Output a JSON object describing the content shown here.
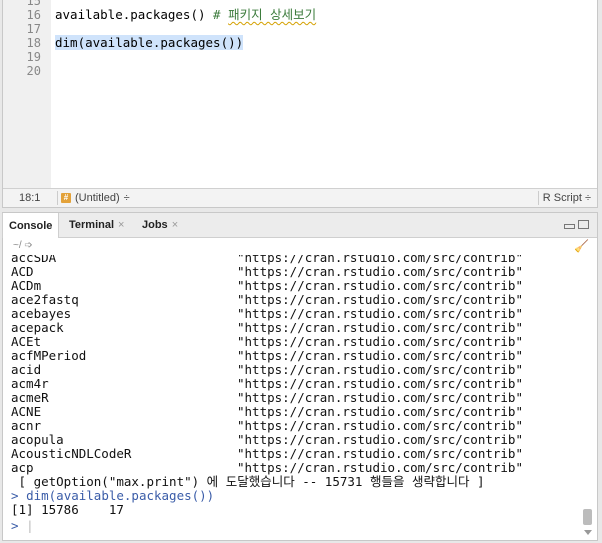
{
  "editor": {
    "lines": [
      {
        "num": "15",
        "text": ""
      },
      {
        "num": "16",
        "code": "available.packages() ",
        "comment_prefix": "# ",
        "comment_text": "패키지 상세보기"
      },
      {
        "num": "17",
        "text": ""
      },
      {
        "num": "18",
        "code": "dim(available.packages())"
      },
      {
        "num": "19",
        "text": ""
      },
      {
        "num": "20",
        "text": ""
      }
    ],
    "status": {
      "position": "18:1",
      "scope_icon": "#",
      "scope": "(Untitled)",
      "scope_arrow": "÷",
      "language": "R Script",
      "language_arrow": "÷"
    }
  },
  "console": {
    "tabs": [
      {
        "label": "Console",
        "closable": false
      },
      {
        "label": "Terminal",
        "closable": true
      },
      {
        "label": "Jobs",
        "closable": true
      }
    ],
    "close_glyph": "×",
    "path": "~/",
    "packages": [
      {
        "name": "accSDA",
        "src": "\"https://cran.rstudio.com/src/contrib\""
      },
      {
        "name": "ACD",
        "src": "\"https://cran.rstudio.com/src/contrib\""
      },
      {
        "name": "ACDm",
        "src": "\"https://cran.rstudio.com/src/contrib\""
      },
      {
        "name": "ace2fastq",
        "src": "\"https://cran.rstudio.com/src/contrib\""
      },
      {
        "name": "acebayes",
        "src": "\"https://cran.rstudio.com/src/contrib\""
      },
      {
        "name": "acepack",
        "src": "\"https://cran.rstudio.com/src/contrib\""
      },
      {
        "name": "ACEt",
        "src": "\"https://cran.rstudio.com/src/contrib\""
      },
      {
        "name": "acfMPeriod",
        "src": "\"https://cran.rstudio.com/src/contrib\""
      },
      {
        "name": "acid",
        "src": "\"https://cran.rstudio.com/src/contrib\""
      },
      {
        "name": "acm4r",
        "src": "\"https://cran.rstudio.com/src/contrib\""
      },
      {
        "name": "acmeR",
        "src": "\"https://cran.rstudio.com/src/contrib\""
      },
      {
        "name": "ACNE",
        "src": "\"https://cran.rstudio.com/src/contrib\""
      },
      {
        "name": "acnr",
        "src": "\"https://cran.rstudio.com/src/contrib\""
      },
      {
        "name": "acopula",
        "src": "\"https://cran.rstudio.com/src/contrib\""
      },
      {
        "name": "AcousticNDLCodeR",
        "src": "\"https://cran.rstudio.com/src/contrib\""
      },
      {
        "name": "acp",
        "src": "\"https://cran.rstudio.com/src/contrib\""
      }
    ],
    "max_print_msg": " [ getOption(\"max.print\") 에 도달했습니다 -- 15731 행들을 생략합니다 ]",
    "prompt_symbol": ">",
    "command": "dim(available.packages())",
    "result": "[1] 15786    17",
    "cursor": "|"
  },
  "colors": {
    "comment": "#3c7b3c",
    "prompt": "#3a5ca8",
    "selection": "#cfe3fb"
  }
}
